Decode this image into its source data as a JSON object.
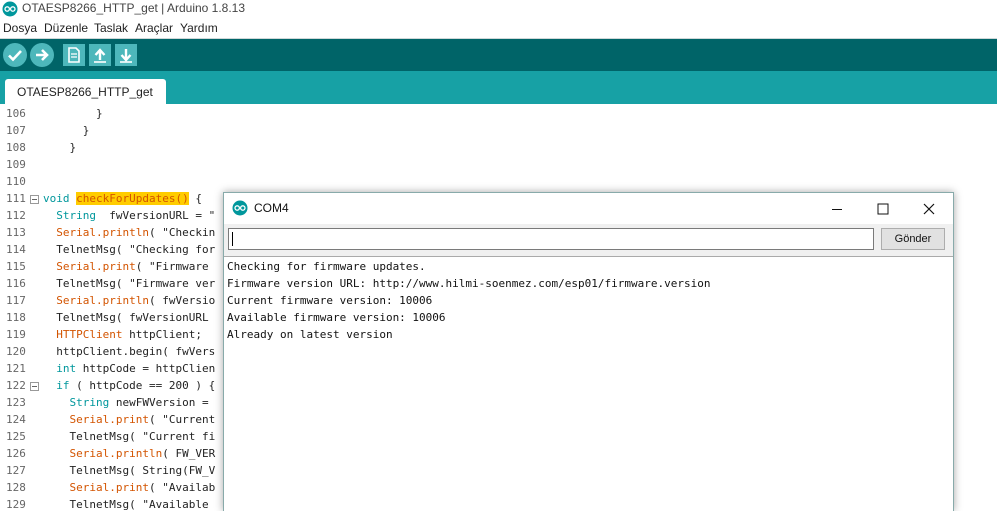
{
  "window": {
    "title": "OTAESP8266_HTTP_get | Arduino 1.8.13"
  },
  "menu": [
    "Dosya",
    "Düzenle",
    "Taslak",
    "Araçlar",
    "Yardım"
  ],
  "toolbar": {
    "buttons": [
      {
        "name": "verify",
        "icon": "check-icon"
      },
      {
        "name": "upload",
        "icon": "arrow-right-icon"
      },
      {
        "name": "new",
        "icon": "new-file-icon"
      },
      {
        "name": "open",
        "icon": "arrow-up-icon"
      },
      {
        "name": "save",
        "icon": "arrow-down-icon"
      }
    ]
  },
  "tab": {
    "label": "OTAESP8266_HTTP_get"
  },
  "editor": {
    "line_numbers": [
      "106",
      "107",
      "108",
      "109",
      "110",
      "111",
      "112",
      "113",
      "114",
      "115",
      "116",
      "117",
      "118",
      "119",
      "120",
      "121",
      "122",
      "123",
      "124",
      "125",
      "126",
      "127",
      "128",
      "129"
    ],
    "lines": [
      {
        "plain": "        }"
      },
      {
        "plain": "      }"
      },
      {
        "plain": "    }"
      },
      {
        "plain": ""
      },
      {
        "plain": ""
      },
      {
        "kw": "void",
        "fn": "checkForUpdates()",
        "rest": " {"
      },
      {
        "kw": "  String",
        "rest": "  fwVersionURL = \""
      },
      {
        "fn": "  Serial.println",
        "rest": "( \"Checkin"
      },
      {
        "plain": "  TelnetMsg( \"Checking for"
      },
      {
        "fn": "  Serial.print",
        "rest": "( \"Firmware"
      },
      {
        "plain": "  TelnetMsg( \"Firmware ver"
      },
      {
        "fn": "  Serial.println",
        "rest": "( fwVersio"
      },
      {
        "plain": "  TelnetMsg( fwVersionURL"
      },
      {
        "fn": "  HTTPClient",
        "rest": " httpClient;"
      },
      {
        "plain": "  httpClient.begin( fwVers"
      },
      {
        "kw": "  int",
        "rest": " httpCode = httpClien"
      },
      {
        "kw": "  if",
        "rest": " ( httpCode == 200 ) {"
      },
      {
        "kw": "    String",
        "rest": " newFWVersion ="
      },
      {
        "fn": "    Serial.print",
        "rest": "( \"Current"
      },
      {
        "plain": "    TelnetMsg( \"Current fi"
      },
      {
        "fn": "    Serial.println",
        "rest": "( FW_VER"
      },
      {
        "plain": "    TelnetMsg( String(FW_V"
      },
      {
        "fn": "    Serial.print",
        "rest": "( \"Availab"
      },
      {
        "plain": "    TelnetMsg( \"Available"
      }
    ]
  },
  "serial_monitor": {
    "title": "COM4",
    "input_value": "",
    "send_label": "Gönder",
    "output": [
      "Checking for firmware updates.",
      "Firmware version URL: http://www.hilmi-soenmez.com/esp01/firmware.version",
      "Current firmware version: 10006",
      "Available firmware version: 10006",
      "Already on latest version"
    ]
  },
  "colors": {
    "toolbar": "#006468",
    "tabbar": "#17a1a5",
    "button": "#4db7bb",
    "highlight": "#ffcc00"
  }
}
